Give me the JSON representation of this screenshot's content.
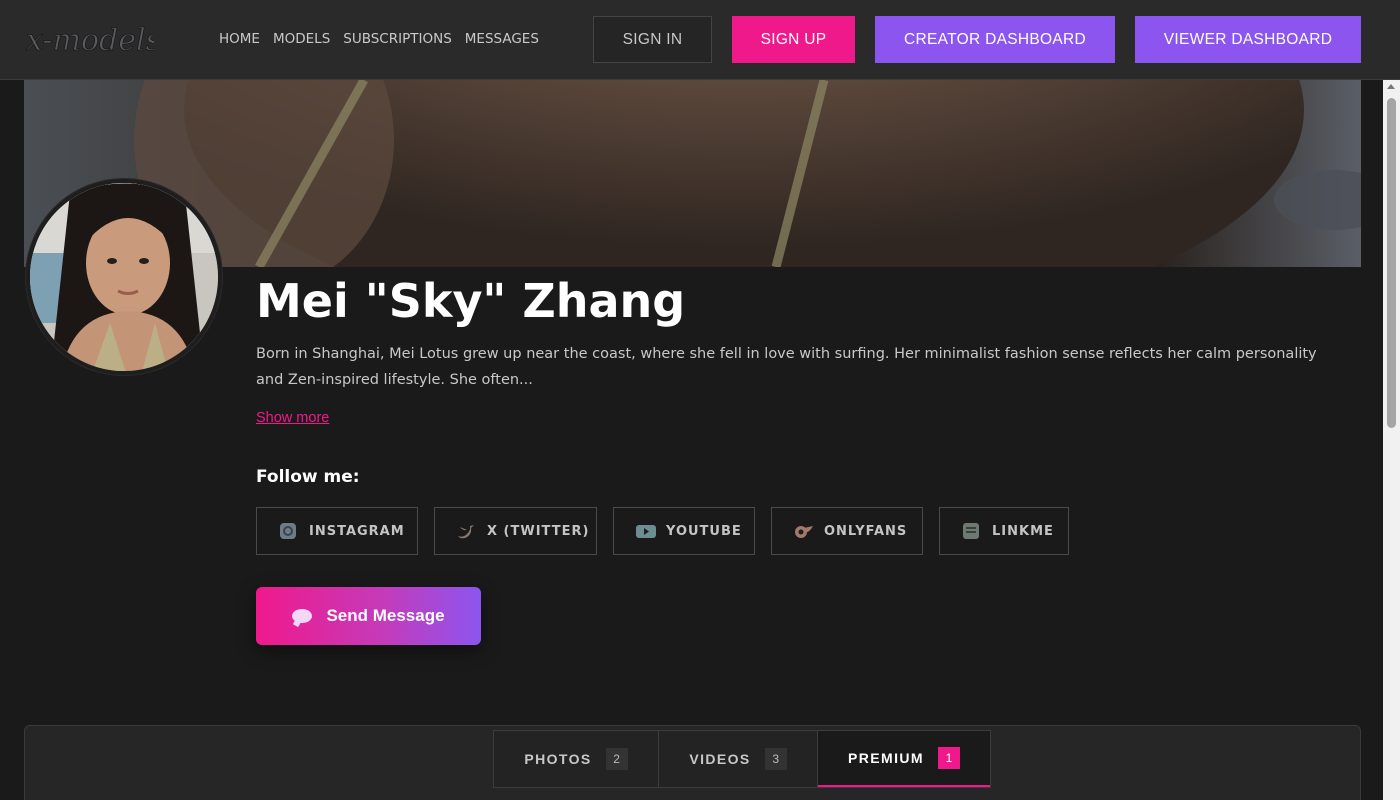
{
  "header": {
    "logo_text": "x-models",
    "nav": [
      "HOME",
      "MODELS",
      "SUBSCRIPTIONS",
      "MESSAGES"
    ],
    "sign_in": "SIGN IN",
    "sign_up": "SIGN UP",
    "creator_dashboard": "CREATOR DASHBOARD",
    "viewer_dashboard": "VIEWER DASHBOARD"
  },
  "profile": {
    "name": "Mei \"Sky\" Zhang",
    "bio": "Born in Shanghai, Mei Lotus grew up near the coast, where she fell in love with surfing. Her minimalist fashion sense reflects her calm personality and Zen-inspired lifestyle. She often...",
    "show_more": "Show more",
    "follow_label": "Follow me:",
    "social": [
      {
        "label": "INSTAGRAM",
        "icon": "instagram-icon"
      },
      {
        "label": "X (TWITTER)",
        "icon": "twitter-icon"
      },
      {
        "label": "YOUTUBE",
        "icon": "youtube-icon"
      },
      {
        "label": "ONLYFANS",
        "icon": "onlyfans-icon"
      },
      {
        "label": "LINKME",
        "icon": "linkme-icon"
      }
    ],
    "send_message": "Send Message"
  },
  "tabs": [
    {
      "label": "PHOTOS",
      "count": "2"
    },
    {
      "label": "VIDEOS",
      "count": "3"
    },
    {
      "label": "PREMIUM",
      "count": "1",
      "active": true
    }
  ],
  "colors": {
    "accent_pink": "#f0198c",
    "accent_purple": "#8d55f0",
    "background": "#1b1a1b"
  }
}
